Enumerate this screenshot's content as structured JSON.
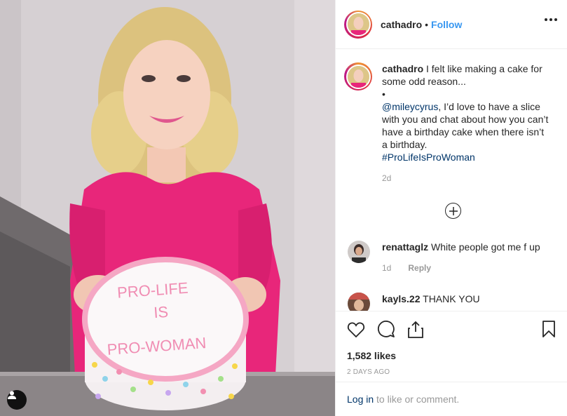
{
  "post": {
    "username": "cathadro",
    "separator": "•",
    "follow_label": "Follow",
    "more_icon": "ellipsis-icon",
    "caption": {
      "username": "cathadro",
      "line1": "I felt like making a cake for some odd reason...",
      "bullet": "•",
      "mention": "@mileycyrus",
      "line2": ", I’d love to have a slice with you and chat about how you can’t have a birthday cake when there isn’t a birthday.",
      "hashtag": "#ProLifeIsProWoman",
      "time": "2d"
    },
    "load_more_icon": "plus-circle-icon",
    "comments": [
      {
        "username": "renattaglz",
        "text": "White people got me f up",
        "time": "1d",
        "reply_label": "Reply"
      },
      {
        "username": "kayls.22",
        "text": "THANK YOU"
      }
    ],
    "likes": "1,582 likes",
    "date": "2 DAYS AGO",
    "login_link": "Log in",
    "login_text": " to like or comment."
  },
  "cake_lettering": "PRO-LIFE IS PRO-WOMAN",
  "colors": {
    "follow": "#3897f0",
    "link": "#003569",
    "muted": "#999999",
    "dress": "#e8267a"
  }
}
